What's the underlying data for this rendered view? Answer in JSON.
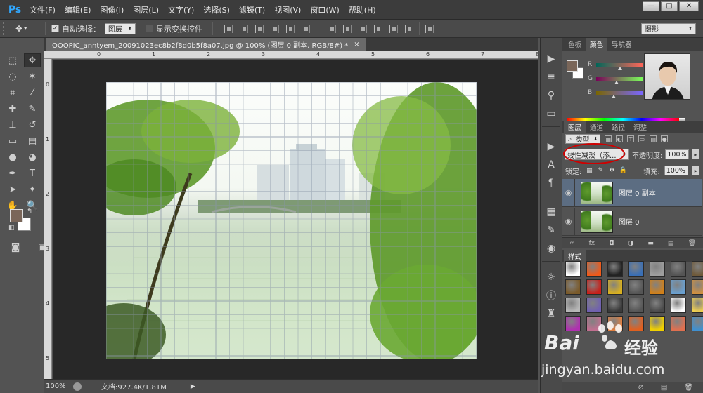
{
  "app": {
    "logo": "Ps",
    "menu": [
      "文件(F)",
      "编辑(E)",
      "图像(I)",
      "图层(L)",
      "文字(Y)",
      "选择(S)",
      "滤镜(T)",
      "视图(V)",
      "窗口(W)",
      "帮助(H)"
    ],
    "window_controls": [
      "—",
      "□",
      "✕"
    ]
  },
  "options_bar": {
    "auto_select_label": "自动选择：",
    "auto_select_checked": true,
    "auto_select_target": "图层",
    "show_transform_label": "显示变换控件",
    "show_transform_checked": false,
    "workspace": "摄影"
  },
  "tools": [
    {
      "icon": "marquee-icon",
      "glyph": "⬚"
    },
    {
      "icon": "move-icon",
      "glyph": "✥",
      "active": true
    },
    {
      "icon": "lasso-icon",
      "glyph": "◌"
    },
    {
      "icon": "magic-wand-icon",
      "glyph": "✶"
    },
    {
      "icon": "crop-icon",
      "glyph": "⌗"
    },
    {
      "icon": "eyedropper-icon",
      "glyph": "⁄"
    },
    {
      "icon": "healing-brush-icon",
      "glyph": "✚"
    },
    {
      "icon": "brush-icon",
      "glyph": "✎"
    },
    {
      "icon": "clone-stamp-icon",
      "glyph": "⊥"
    },
    {
      "icon": "history-brush-icon",
      "glyph": "↺"
    },
    {
      "icon": "eraser-icon",
      "glyph": "▭"
    },
    {
      "icon": "gradient-icon",
      "glyph": "▤"
    },
    {
      "icon": "blur-icon",
      "glyph": "●"
    },
    {
      "icon": "dodge-icon",
      "glyph": "◕"
    },
    {
      "icon": "pen-icon",
      "glyph": "✒"
    },
    {
      "icon": "type-icon",
      "glyph": "T"
    },
    {
      "icon": "path-selection-icon",
      "glyph": "➤"
    },
    {
      "icon": "shape-icon",
      "glyph": "✦"
    },
    {
      "icon": "hand-icon",
      "glyph": "✋"
    },
    {
      "icon": "zoom-icon",
      "glyph": "🔍"
    }
  ],
  "document": {
    "tab_title": "OOOPIC_anntyem_20091023ec8b2f8d0b5f8a07.jpg @ 100% (图层 0 副本, RGB/8#) *",
    "close": "×",
    "ruler_top": [
      "0",
      "1",
      "2",
      "3",
      "4",
      "5",
      "6",
      "7",
      "8"
    ],
    "ruler_left": [
      "0",
      "1",
      "2",
      "3",
      "4",
      "5"
    ]
  },
  "status": {
    "zoom": "100%",
    "doc_size": "文档:927.4K/1.81M",
    "arrow": "▶"
  },
  "color_panel": {
    "tabs": [
      "色板",
      "颜色",
      "导航器"
    ],
    "active_tab": "颜色",
    "labels": [
      "R",
      "G",
      "B"
    ],
    "fg_color": "#7a6659",
    "bg_color": "#ffffff"
  },
  "layers_panel": {
    "tabs": [
      "图层",
      "通道",
      "路径",
      "调整"
    ],
    "active_tab": "图层",
    "filter_kind": "类型",
    "blend_mode": "线性减淡（添...",
    "opacity_label": "不透明度:",
    "opacity": "100%",
    "lock_label": "锁定:",
    "fill_label": "填充:",
    "fill": "100%",
    "layers": [
      {
        "name": "图层 0 副本",
        "selected": true
      },
      {
        "name": "图层 0",
        "selected": false
      }
    ],
    "footer_icons": [
      "∞",
      "fx",
      "◘",
      "◑",
      "▬",
      "▤",
      "🗑"
    ]
  },
  "styles_panel": {
    "title": "样式",
    "swatches": [
      "#ffffff",
      "#f05a1a",
      "#222222",
      "#3a6fb5",
      "#9e9e9e",
      "#555555",
      "#6f5a3a",
      "#7a5a2a",
      "#c8201a",
      "#d8b020",
      "#555555",
      "#d0801a",
      "#6aa0d0",
      "#d09040",
      "#b8b8b8",
      "#7060b0",
      "#3a3a3a",
      "#555555",
      "#4a4a4a",
      "#ffffff",
      "#f0d050",
      "#b030b0",
      "#c07090",
      "#e08040",
      "#e06020",
      "#f0d000",
      "#e07050",
      "#4090d0"
    ]
  },
  "watermark": {
    "brand": "Bai",
    "brand2": "经验",
    "url": "jingyan.baidu.com"
  }
}
